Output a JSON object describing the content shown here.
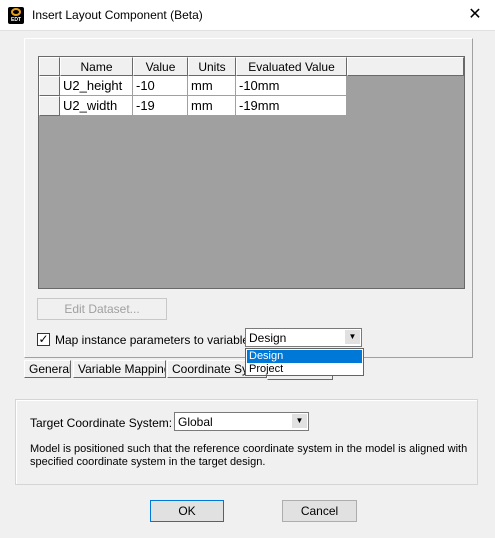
{
  "window": {
    "title": "Insert Layout Component (Beta)",
    "app_icon_text": "EDT",
    "close_glyph": "✕"
  },
  "grid": {
    "columns": [
      "Name",
      "Value",
      "Units",
      "Evaluated Value"
    ],
    "rows": [
      [
        "U2_height",
        "-10",
        "mm",
        "-10mm"
      ],
      [
        "U2_width",
        "-19",
        "mm",
        "-19mm"
      ]
    ]
  },
  "edit_dataset_label": "Edit Dataset...",
  "map_checkbox": {
    "checked": true,
    "mark": "✓",
    "label": "Map instance parameters to variables:"
  },
  "mapping_combo": {
    "value": "Design",
    "options": [
      "Design",
      "Project"
    ],
    "selected": "Design"
  },
  "tabs": [
    {
      "label": "General"
    },
    {
      "label": "Variable Mapping"
    },
    {
      "label": "Coordinate System"
    }
  ],
  "target_coordinate": {
    "label": "Target Coordinate System:",
    "value": "Global",
    "description": "Model is positioned such that the reference coordinate system in the model is aligned with specified coordinate system in the target design."
  },
  "buttons": {
    "ok": "OK",
    "cancel": "Cancel"
  },
  "icons": {
    "dropdown_arrow": "▼"
  },
  "colors": {
    "selection": "#0078d7",
    "grid_background": "#a0a0a0",
    "dialog_background": "#f0f0f0"
  }
}
